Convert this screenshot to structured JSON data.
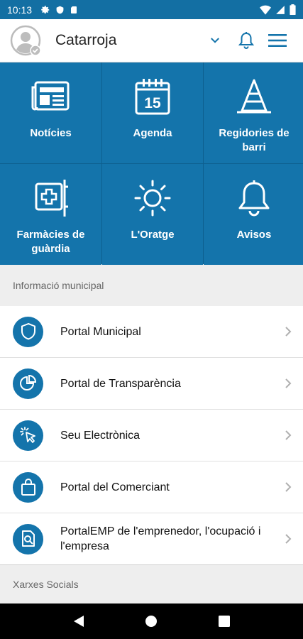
{
  "status_bar": {
    "time": "10:13",
    "icons": [
      "gear-icon",
      "shield-icon",
      "sd-card-icon"
    ],
    "right_icons": [
      "wifi-icon",
      "signal-icon",
      "battery-icon"
    ]
  },
  "header": {
    "title": "Catarroja",
    "icons": [
      "avatar",
      "chevron-down-icon",
      "bell-icon",
      "menu-icon"
    ],
    "accent": "#1474ab"
  },
  "tiles": [
    {
      "label": "Notícies",
      "icon": "newspaper-icon"
    },
    {
      "label": "Agenda",
      "icon": "calendar-icon",
      "day": "15"
    },
    {
      "label": "Regidories de barri",
      "icon": "traffic-cone-icon"
    },
    {
      "label": "Farmàcies de guàrdia",
      "icon": "pharmacy-icon"
    },
    {
      "label": "L'Oratge",
      "icon": "sun-icon"
    },
    {
      "label": "Avisos",
      "icon": "bell-icon"
    }
  ],
  "sections": {
    "municipal": "Informació municipal",
    "social": "Xarxes Socials"
  },
  "municipal_items": [
    {
      "label": "Portal Municipal",
      "icon": "shield-icon"
    },
    {
      "label": "Portal de Transparència",
      "icon": "pie-chart-icon"
    },
    {
      "label": "Seu Electrònica",
      "icon": "cursor-click-icon"
    },
    {
      "label": "Portal del Comerciant",
      "icon": "shopping-bag-icon"
    },
    {
      "label": "PortalEMP de l'emprenedor, l'ocupació i l'empresa",
      "icon": "document-search-icon"
    }
  ],
  "colors": {
    "tile": "#1474ab",
    "tile_border": "#0d5f8f",
    "status_bar": "#136fa3",
    "background": "#eeeeee"
  }
}
